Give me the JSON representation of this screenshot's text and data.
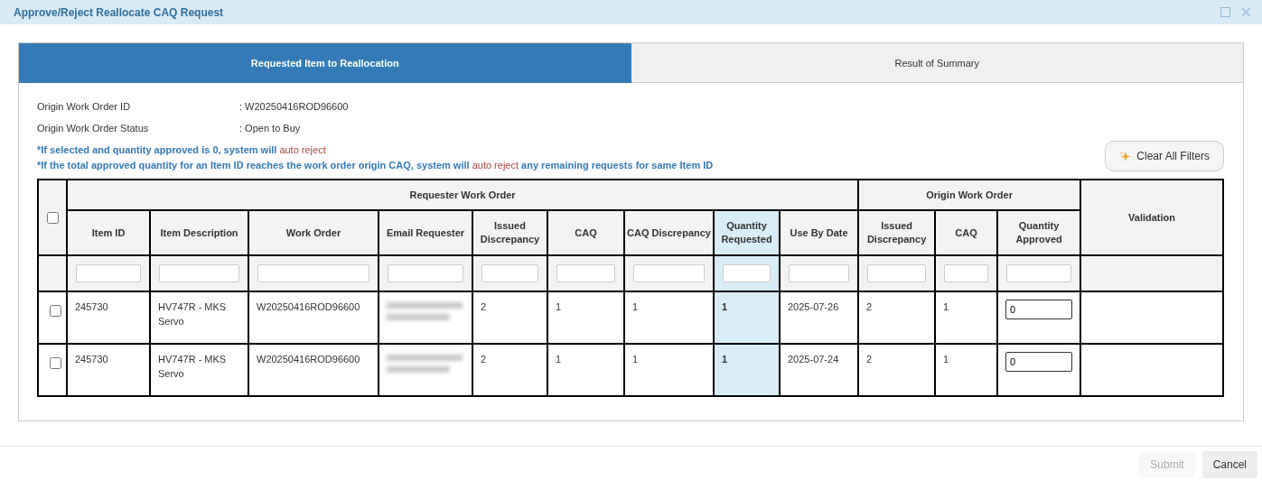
{
  "window": {
    "title": "Approve/Reject Reallocate CAQ Request"
  },
  "tabs": [
    {
      "label": "Requested Item to Reallocation",
      "selected": true
    },
    {
      "label": "Result of Summary",
      "selected": false
    }
  ],
  "info": [
    {
      "label": "Origin Work Order ID",
      "value": ": W20250416ROD96600"
    },
    {
      "label": "Origin Work Order Status",
      "value": ": Open to Buy"
    }
  ],
  "notes": [
    [
      {
        "text": "*If selected and quantity approved is 0, system will ",
        "alert": false
      },
      {
        "text": "auto reject",
        "alert": true
      }
    ],
    [
      {
        "text": "*If the total approved quantity for an Item ID reaches the work order origin CAQ, system will ",
        "alert": false
      },
      {
        "text": "auto reject",
        "alert": true
      },
      {
        "text": " any remaining requests for same Item ID",
        "alert": false
      }
    ]
  ],
  "clear_filters_button": "Clear All Filters",
  "table": {
    "select_all_checked": false,
    "groups": [
      {
        "label": "Requester Work Order",
        "columns": [
          {
            "label": "Item ID",
            "kind": "text",
            "highlighted": false
          },
          {
            "label": "Item Description",
            "kind": "text",
            "highlighted": false
          },
          {
            "label": "Work Order",
            "kind": "text",
            "highlighted": false
          },
          {
            "label": "Email Requester",
            "kind": "redacted",
            "highlighted": false
          },
          {
            "label": "Issued Discrepancy",
            "kind": "text",
            "highlighted": false
          },
          {
            "label": "CAQ",
            "kind": "text",
            "highlighted": false
          },
          {
            "label": "CAQ Discrepancy",
            "kind": "text",
            "highlighted": false
          },
          {
            "label": "Quantity Requested",
            "kind": "bold",
            "highlighted": true
          },
          {
            "label": "Use By Date",
            "kind": "text",
            "highlighted": false
          }
        ]
      },
      {
        "label": "Origin Work Order",
        "columns": [
          {
            "label": "Issued Discrepancy",
            "kind": "text",
            "highlighted": false
          },
          {
            "label": "CAQ",
            "kind": "text",
            "highlighted": false
          },
          {
            "label": "Quantity Approved",
            "kind": "input",
            "highlighted": false
          }
        ]
      }
    ],
    "validation_header": "Validation",
    "rows": [
      {
        "checked": false,
        "cells": [
          "245730",
          "HV747R - MKS Servo",
          "W20250416ROD96600",
          "",
          "2",
          "1",
          "1",
          "1",
          "2025-07-26",
          "2",
          "1",
          "0"
        ]
      },
      {
        "checked": false,
        "cells": [
          "245730",
          "HV747R - MKS Servo",
          "W20250416ROD96600",
          "",
          "2",
          "1",
          "1",
          "1",
          "2025-07-24",
          "2",
          "1",
          "0"
        ]
      }
    ]
  },
  "buttons": [
    {
      "label": "Submit",
      "disabled": true
    },
    {
      "label": "Cancel",
      "disabled": false
    }
  ]
}
